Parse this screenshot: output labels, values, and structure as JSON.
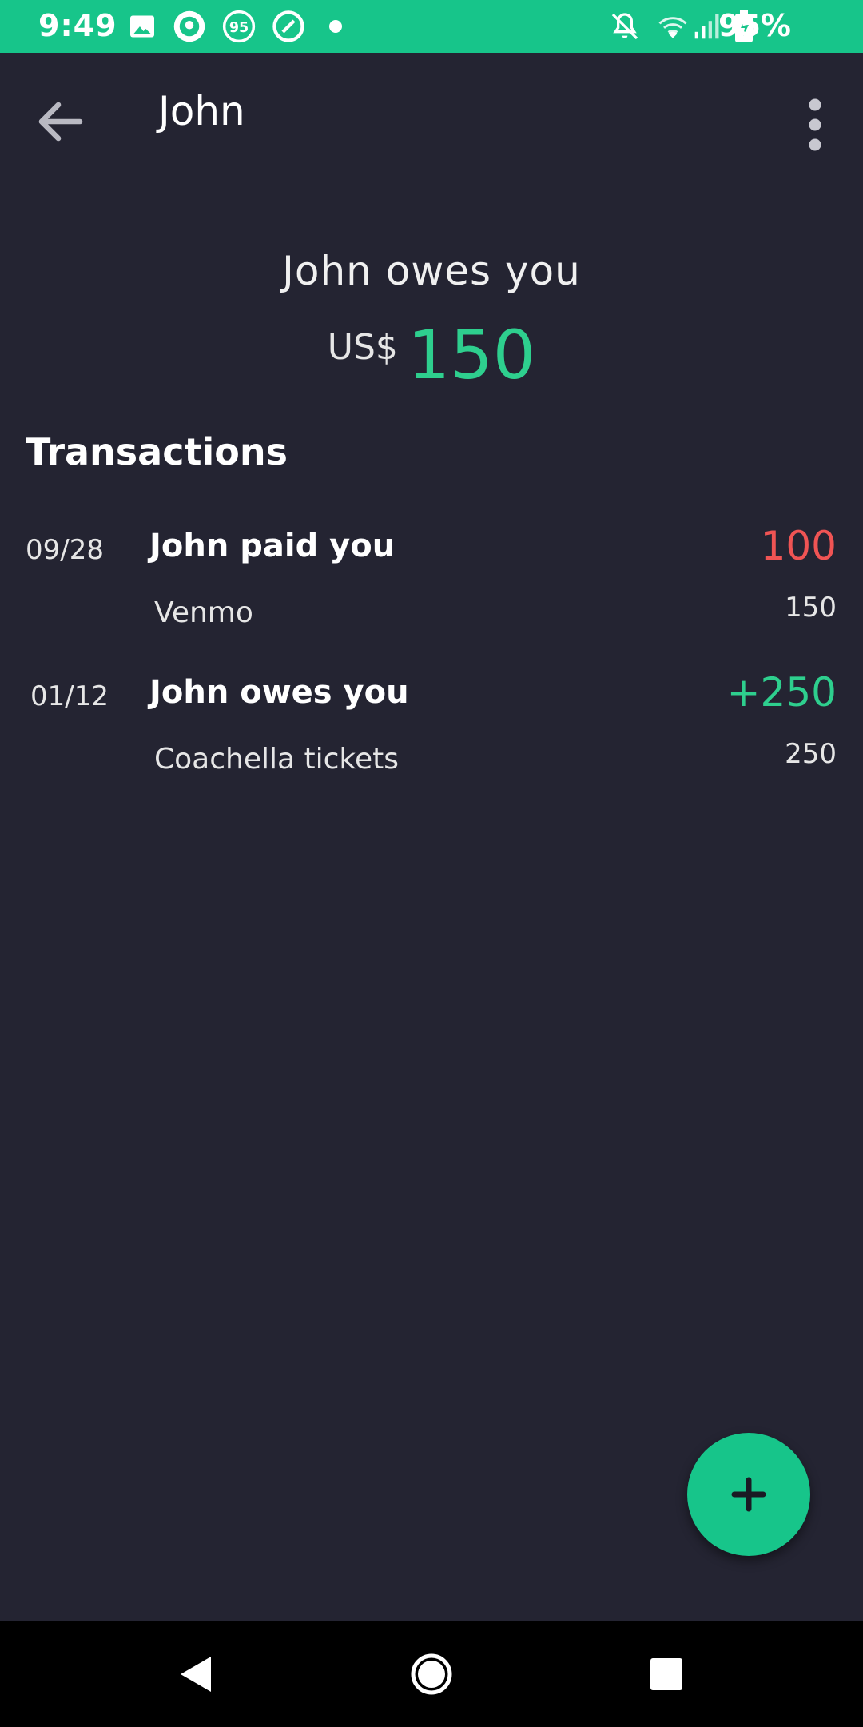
{
  "status_bar": {
    "time": "9:49",
    "notification_icons": [
      "image-icon",
      "starbucks-icon",
      "badge-95-icon",
      "circle-app-icon",
      "dot-icon"
    ],
    "system_icons": [
      "bell-off-icon",
      "wifi-icon",
      "signal-icon",
      "battery-charging-icon"
    ],
    "battery": "95%",
    "color": "#17c58a"
  },
  "app_bar": {
    "title": "John",
    "back_icon": "arrow-left-icon",
    "menu_icon": "more-vert-icon"
  },
  "summary": {
    "label": "John owes you",
    "currency": "US$",
    "amount": "150",
    "amount_color": "#2ecf8e"
  },
  "transactions_header": "Transactions",
  "transactions": [
    {
      "date": "09/28",
      "description": "John paid you",
      "amount": "100",
      "amount_color": "#f05454",
      "subtitle": "Venmo",
      "sub_amount": "150"
    },
    {
      "date": "01/12",
      "description": "John owes you",
      "amount": "+250",
      "amount_color": "#2ecf8e",
      "subtitle": "Coachella tickets",
      "sub_amount": "250"
    }
  ],
  "fab": {
    "icon": "plus-icon",
    "color": "#17c58a"
  },
  "nav_bar": {
    "buttons": [
      "back-triangle-icon",
      "home-circle-icon",
      "recents-square-icon"
    ]
  }
}
